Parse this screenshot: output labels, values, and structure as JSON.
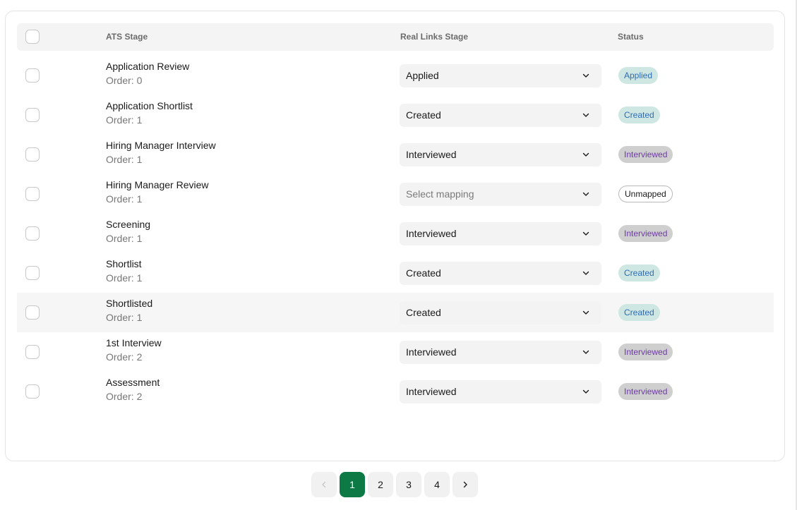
{
  "table": {
    "headers": {
      "ats_stage": "ATS Stage",
      "real_links_stage": "Real Links Stage",
      "status": "Status"
    },
    "rows": [
      {
        "name": "Application Review",
        "order": "Order: 0",
        "mapping": "Applied",
        "status": "Applied",
        "status_kind": "applied"
      },
      {
        "name": "Application Shortlist",
        "order": "Order: 1",
        "mapping": "Created",
        "status": "Created",
        "status_kind": "created"
      },
      {
        "name": "Hiring Manager Interview",
        "order": "Order: 1",
        "mapping": "Interviewed",
        "status": "Interviewed",
        "status_kind": "interviewed"
      },
      {
        "name": "Hiring Manager Review",
        "order": "Order: 1",
        "mapping": "Select mapping",
        "status": "Unmapped",
        "status_kind": "unmapped"
      },
      {
        "name": "Screening",
        "order": "Order: 1",
        "mapping": "Interviewed",
        "status": "Interviewed",
        "status_kind": "interviewed"
      },
      {
        "name": "Shortlist",
        "order": "Order: 1",
        "mapping": "Created",
        "status": "Created",
        "status_kind": "created"
      },
      {
        "name": "Shortlisted",
        "order": "Order: 1",
        "mapping": "Created",
        "status": "Created",
        "status_kind": "created"
      },
      {
        "name": "1st Interview",
        "order": "Order: 2",
        "mapping": "Interviewed",
        "status": "Interviewed",
        "status_kind": "interviewed"
      },
      {
        "name": "Assessment",
        "order": "Order: 2",
        "mapping": "Interviewed",
        "status": "Interviewed",
        "status_kind": "interviewed"
      }
    ]
  },
  "pagination": {
    "prev_icon": "chevron-left-icon",
    "next_icon": "chevron-right-icon",
    "pages": [
      "1",
      "2",
      "3",
      "4"
    ],
    "current": "1"
  },
  "colors": {
    "accent": "#0d7a45",
    "badge_created_bg": "#cfe7e2",
    "badge_created_text": "#2e6bb8",
    "badge_interviewed_bg": "#cfcfcf",
    "badge_interviewed_text": "#6e3aa6"
  }
}
